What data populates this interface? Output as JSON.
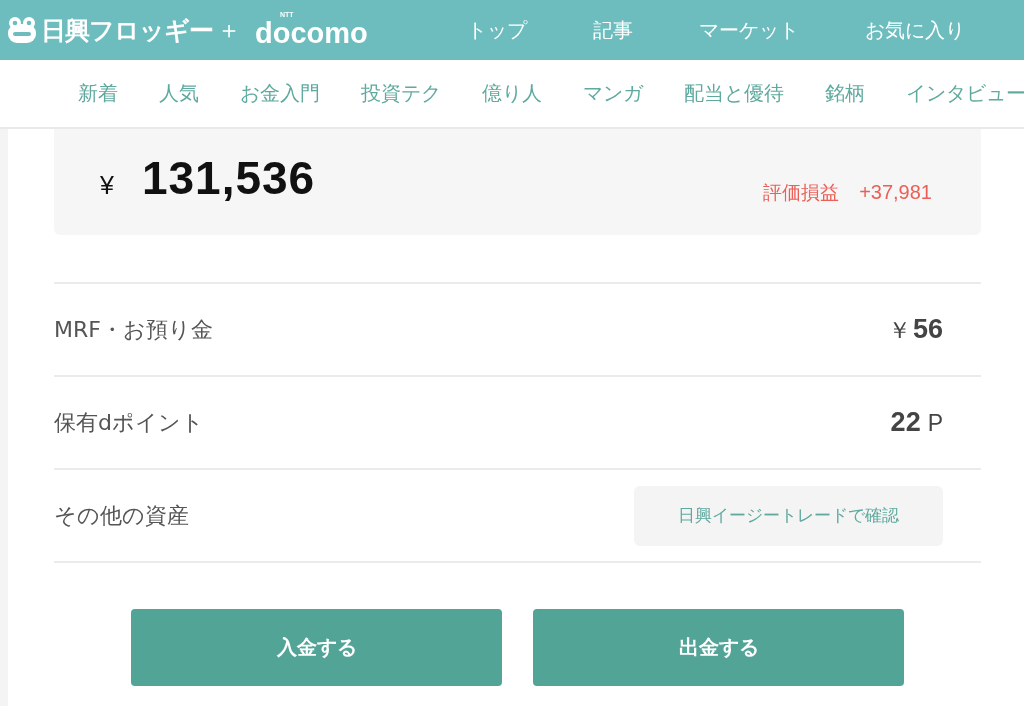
{
  "header": {
    "logo": {
      "name": "日興フロッギー",
      "plus": "＋",
      "partner": "docomo",
      "partner_mark": "NTT"
    },
    "nav": [
      {
        "label": "トップ"
      },
      {
        "label": "記事"
      },
      {
        "label": "マーケット"
      },
      {
        "label": "お気に入り"
      }
    ]
  },
  "category_nav": [
    {
      "label": "新着"
    },
    {
      "label": "人気"
    },
    {
      "label": "お金入門"
    },
    {
      "label": "投資テク"
    },
    {
      "label": "億り人"
    },
    {
      "label": "マンガ"
    },
    {
      "label": "配当と優待"
    },
    {
      "label": "銘柄"
    },
    {
      "label": "インタビュー"
    }
  ],
  "summary": {
    "currency": "¥",
    "total": "131,536",
    "gain_label": "評価損益",
    "gain_value": "+37,981"
  },
  "rows": [
    {
      "kind": "amount",
      "label": "MRF・お預り金",
      "prefix": "￥",
      "value": "56"
    },
    {
      "kind": "amount",
      "label": "保有dポイント",
      "value": "22",
      "suffix": "P"
    },
    {
      "kind": "link",
      "label": "その他の資産",
      "action": "日興イージートレードで確認"
    }
  ],
  "actions": [
    "入金する",
    "出金する"
  ]
}
